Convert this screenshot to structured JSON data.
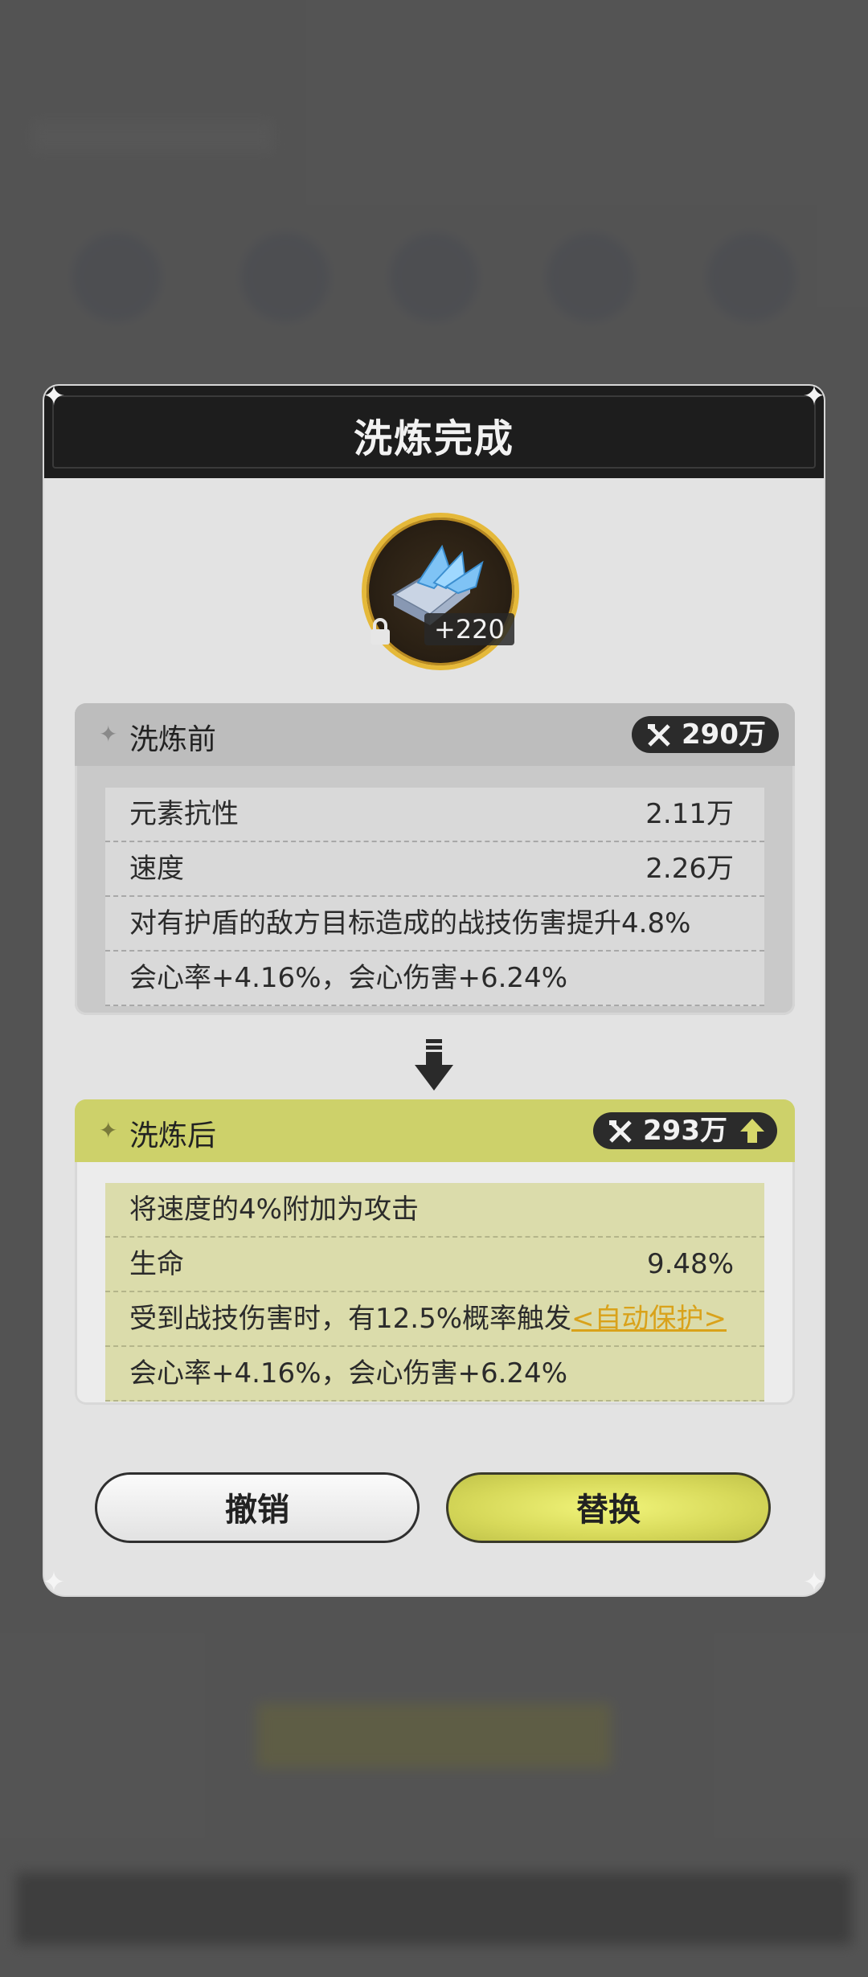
{
  "dialog": {
    "title": "洗炼完成",
    "item": {
      "level": "+220",
      "locked": true
    },
    "before": {
      "label": "洗炼前",
      "power": "290万",
      "stats": [
        {
          "name": "元素抗性",
          "value": "2.11万"
        },
        {
          "name": "速度",
          "value": "2.26万"
        },
        {
          "name": "对有护盾的敌方目标造成的战技伤害提升4.8%",
          "value": ""
        },
        {
          "name": "会心率+4.16%，会心伤害+6.24%",
          "value": ""
        }
      ]
    },
    "after": {
      "label": "洗炼后",
      "power": "293万",
      "stats": [
        {
          "name": "将速度的4%附加为攻击",
          "value": ""
        },
        {
          "name": "生命",
          "value": "9.48%"
        },
        {
          "name": "受到战技伤害时，有12.5%概率触发",
          "link": "<自动保护>"
        },
        {
          "name": "会心率+4.16%，会心伤害+6.24%",
          "value": ""
        }
      ]
    },
    "buttons": {
      "cancel": "撤销",
      "replace": "替换"
    }
  },
  "colors": {
    "header": "#1d1d1d",
    "panel_after_head": "#cdd16a",
    "link": "#d9a21a",
    "ring": "#e5b93a"
  }
}
